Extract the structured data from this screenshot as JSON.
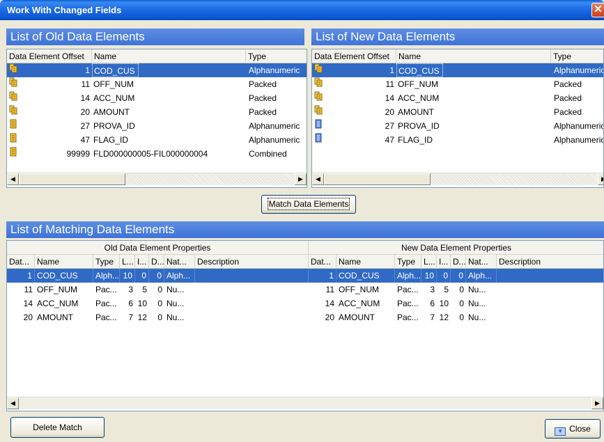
{
  "window": {
    "title": "Work With Changed Fields",
    "close_glyph": "✕"
  },
  "old_list": {
    "header": "List of Old Data Elements",
    "columns": [
      "Data Element Offset",
      "Name",
      "Type"
    ],
    "rows": [
      {
        "icon": "multi-field-icon",
        "offset": "1",
        "name": "COD_CUS",
        "type": "Alphanumeric",
        "selected": true
      },
      {
        "icon": "multi-field-icon",
        "offset": "11",
        "name": "OFF_NUM",
        "type": "Packed"
      },
      {
        "icon": "multi-field-icon",
        "offset": "14",
        "name": "ACC_NUM",
        "type": "Packed"
      },
      {
        "icon": "multi-field-icon",
        "offset": "20",
        "name": "AMOUNT",
        "type": "Packed"
      },
      {
        "icon": "field-icon",
        "offset": "27",
        "name": "PROVA_ID",
        "type": "Alphanumeric"
      },
      {
        "icon": "field-icon",
        "offset": "47",
        "name": "FLAG_ID",
        "type": "Alphanumeric"
      },
      {
        "icon": "field-icon",
        "offset": "99999",
        "name": "FLD000000005-FIL000000004",
        "type": "Combined"
      }
    ]
  },
  "new_list": {
    "header": "List of New Data Elements",
    "columns": [
      "Data Element Offset",
      "Name",
      "Type"
    ],
    "rows": [
      {
        "icon": "multi-field-icon",
        "offset": "1",
        "name": "COD_CUS",
        "type": "Alphanumeric",
        "selected": true
      },
      {
        "icon": "multi-field-icon",
        "offset": "11",
        "name": "OFF_NUM",
        "type": "Packed"
      },
      {
        "icon": "multi-field-icon",
        "offset": "14",
        "name": "ACC_NUM",
        "type": "Packed"
      },
      {
        "icon": "multi-field-icon",
        "offset": "20",
        "name": "AMOUNT",
        "type": "Packed"
      },
      {
        "icon": "blue-field-icon",
        "offset": "27",
        "name": "PROVA_ID",
        "type": "Alphanumeric"
      },
      {
        "icon": "blue-field-icon",
        "offset": "47",
        "name": "FLAG_ID",
        "type": "Alphanumeric"
      }
    ]
  },
  "match_button": "Match Data Elements",
  "matching": {
    "header": "List of Matching Data Elements",
    "old_group": "Old Data Element Properties",
    "new_group": "New Data Element Properties",
    "columns": [
      "Dat...",
      "Name",
      "Type",
      "L...",
      "I...",
      "D...",
      "Nat...",
      "Description"
    ],
    "rows": [
      {
        "offset": "1",
        "name": "COD_CUS",
        "type": "Alph...",
        "len": "10",
        "int": "0",
        "dec": "0",
        "nat": "Alph...",
        "desc": "",
        "selected": true,
        "n_offset": "1",
        "n_name": "COD_CUS",
        "n_type": "Alph...",
        "n_len": "10",
        "n_int": "0",
        "n_dec": "0",
        "n_nat": "Alph...",
        "n_desc": ""
      },
      {
        "offset": "11",
        "name": "OFF_NUM",
        "type": "Pac...",
        "len": "3",
        "int": "5",
        "dec": "0",
        "nat": "Nu...",
        "desc": "",
        "n_offset": "11",
        "n_name": "OFF_NUM",
        "n_type": "Pac...",
        "n_len": "3",
        "n_int": "5",
        "n_dec": "0",
        "n_nat": "Nu...",
        "n_desc": ""
      },
      {
        "offset": "14",
        "name": "ACC_NUM",
        "type": "Pac...",
        "len": "6",
        "int": "10",
        "dec": "0",
        "nat": "Nu...",
        "desc": "",
        "n_offset": "14",
        "n_name": "ACC_NUM",
        "n_type": "Pac...",
        "n_len": "6",
        "n_int": "10",
        "n_dec": "0",
        "n_nat": "Nu...",
        "n_desc": ""
      },
      {
        "offset": "20",
        "name": "AMOUNT",
        "type": "Pac...",
        "len": "7",
        "int": "12",
        "dec": "0",
        "nat": "Nu...",
        "desc": "",
        "n_offset": "20",
        "n_name": "AMOUNT",
        "n_type": "Pac...",
        "n_len": "7",
        "n_int": "12",
        "n_dec": "0",
        "n_nat": "Nu...",
        "n_desc": ""
      }
    ]
  },
  "buttons": {
    "delete": "Delete Match",
    "close": "Close"
  },
  "colors": {
    "selection": "#316ac5",
    "header_blue": "#4a7fdc",
    "title_blue": "#0b56d4"
  }
}
